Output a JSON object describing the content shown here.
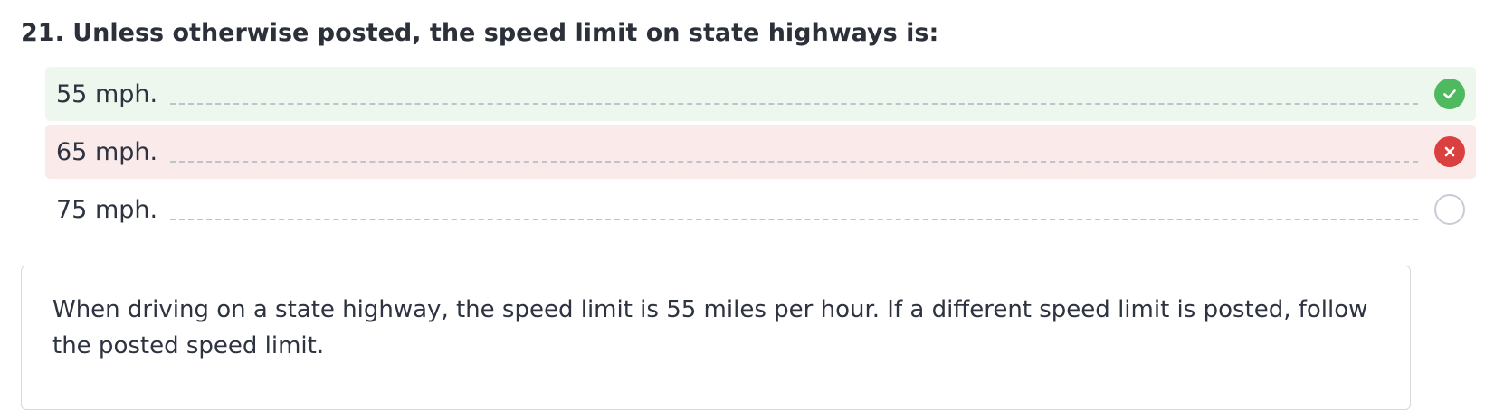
{
  "question": {
    "text": "21. Unless otherwise posted, the speed limit on state highways is:"
  },
  "options": [
    {
      "label": "55 mph.",
      "state": "correct",
      "icon": "check-circle-icon"
    },
    {
      "label": "65 mph.",
      "state": "wrong",
      "icon": "x-circle-icon"
    },
    {
      "label": "75 mph.",
      "state": "unselected",
      "icon": "empty-radio-icon"
    }
  ],
  "explanation": {
    "text": "When driving on a state highway, the speed limit is 55 miles per hour. If a different speed limit is posted, follow the posted speed limit."
  },
  "colors": {
    "correct_bg": "#edf7ee",
    "correct_icon": "#4fb95f",
    "wrong_bg": "#fbeaea",
    "wrong_icon": "#d9403f",
    "text": "#2d3340"
  }
}
